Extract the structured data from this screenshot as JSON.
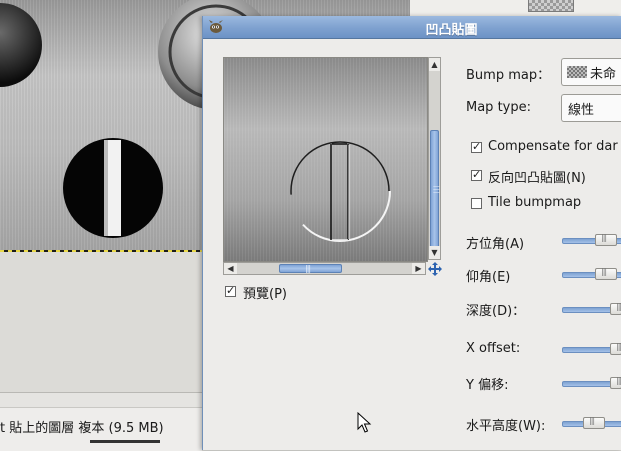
{
  "background": {
    "status_text": "貼上的圖層 複本 (9.5 MB)",
    "status_char_left": "t"
  },
  "dialog": {
    "title": "凹凸貼圖",
    "preview": {
      "checkbox_label": "預覽(P)",
      "checked": true
    },
    "bump_map": {
      "label": "Bump map：",
      "value": "未命"
    },
    "map_type": {
      "label": "Map type:",
      "value": "線性"
    },
    "options": [
      {
        "label": "Compensate for dar",
        "checked": true
      },
      {
        "label": "反向凹凸貼圖(N)",
        "checked": true
      },
      {
        "label": "Tile bumpmap",
        "checked": false
      }
    ],
    "sliders": [
      {
        "label": "方位角(A)",
        "level": 0.75
      },
      {
        "label": "仰角(E)",
        "level": 0.75
      },
      {
        "label": "深度(D)：",
        "level": 0.95
      },
      {
        "label": "X offset:",
        "level": 0.95
      },
      {
        "label": "Y 偏移:",
        "level": 0.95
      },
      {
        "label": "水平高度(W):",
        "level": 0.45
      }
    ]
  },
  "colors": {
    "title_bar": "#7ea1cf",
    "accent": "#6c92c6",
    "dialog_bg": "#edecea"
  }
}
